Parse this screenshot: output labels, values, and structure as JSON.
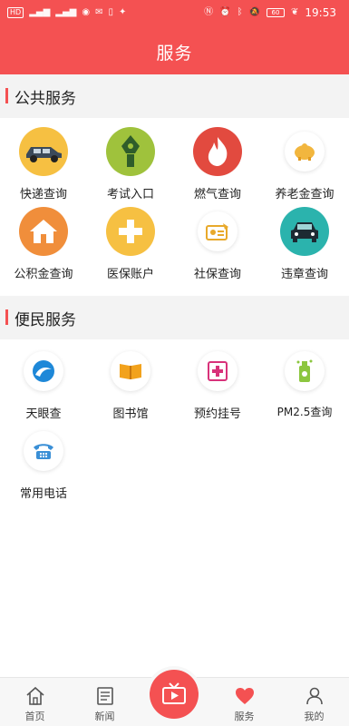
{
  "status_bar": {
    "left_items": [
      "HD",
      "4G",
      "4G",
      "WiFi",
      "Eye",
      "Mail",
      "SIM",
      "Bell"
    ],
    "battery": "60",
    "time": "19:53"
  },
  "header": {
    "title": "服务"
  },
  "public_services": {
    "title": "公共服务",
    "items": [
      {
        "label": "快递查询",
        "icon": "car-icon",
        "color": "#f6c042"
      },
      {
        "label": "考试入口",
        "icon": "pen-nib-icon",
        "color": "#9fc23c"
      },
      {
        "label": "燃气查询",
        "icon": "flame-icon",
        "color": "#e24a3f"
      },
      {
        "label": "养老金查询",
        "icon": "piggy-bank-icon",
        "color": "#f2b63e"
      },
      {
        "label": "公积金查询",
        "icon": "house-icon",
        "color": "#f08e3b"
      },
      {
        "label": "医保账户",
        "icon": "medical-cross-icon",
        "color": "#f6c042"
      },
      {
        "label": "社保查询",
        "icon": "id-card-icon",
        "color": "#e8a92b"
      },
      {
        "label": "违章查询",
        "icon": "car-front-icon",
        "color": "#2bb3ad"
      }
    ]
  },
  "civic_services": {
    "title": "便民服务",
    "items": [
      {
        "label": "天眼查",
        "icon": "wave-icon",
        "color": "#1e88d8"
      },
      {
        "label": "图书馆",
        "icon": "book-icon",
        "color": "#f2a21c"
      },
      {
        "label": "预约挂号",
        "icon": "plus-box-icon",
        "color": "#d8327a"
      },
      {
        "label": "PM2.5查询",
        "icon": "air-sensor-icon",
        "color": "#8cc63f"
      },
      {
        "label": "常用电话",
        "icon": "telephone-icon",
        "color": "#3a8fd6"
      }
    ]
  },
  "tabbar": {
    "items": [
      {
        "label": "首页",
        "icon": "home-icon",
        "active": false
      },
      {
        "label": "新闻",
        "icon": "news-icon",
        "active": false
      },
      {
        "label": "服务",
        "icon": "heart-icon",
        "active": true
      },
      {
        "label": "我的",
        "icon": "person-icon",
        "active": false
      }
    ],
    "center_icon": "tv-play-icon"
  },
  "colors": {
    "brand": "#f45152",
    "section_bg": "#f3f3f3"
  }
}
